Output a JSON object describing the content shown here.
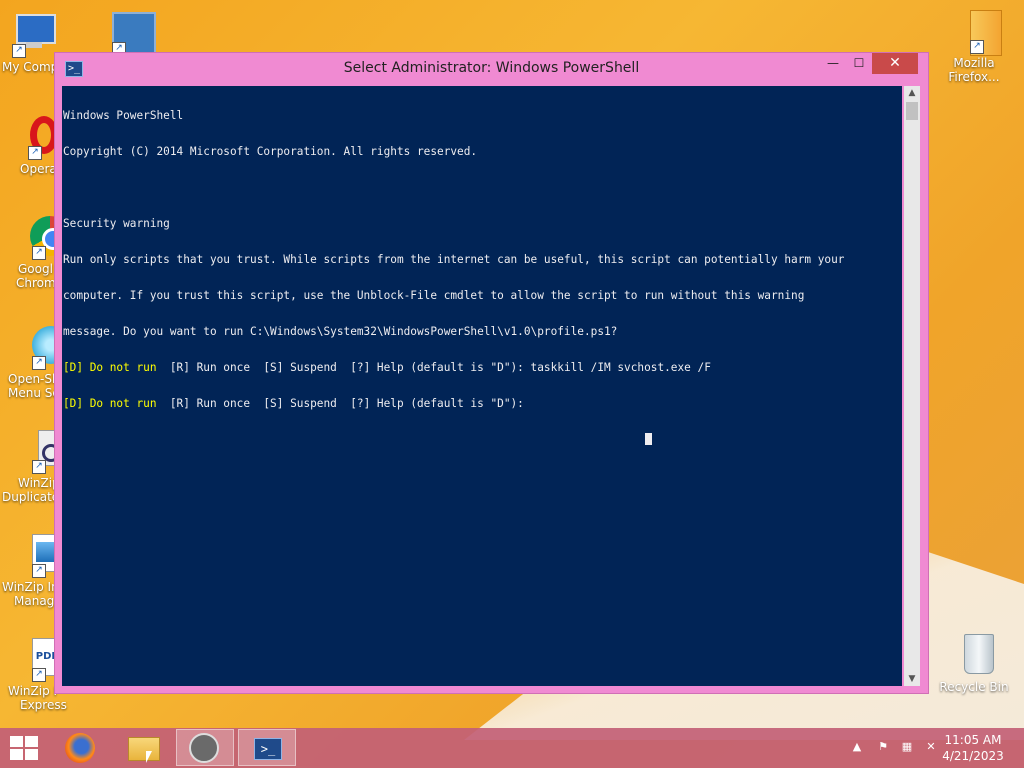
{
  "window": {
    "title": "Select Administrator: Windows PowerShell",
    "buttons": {
      "minimize": "—",
      "maximize": "☐",
      "close": "✕"
    }
  },
  "console": {
    "lines": [
      "Windows PowerShell",
      "Copyright (C) 2014 Microsoft Corporation. All rights reserved.",
      "",
      "Security warning",
      "Run only scripts that you trust. While scripts from the internet can be useful, this script can potentially harm your",
      "computer. If you trust this script, use the Unblock-File cmdlet to allow the script to run without this warning",
      "message. Do you want to run C:\\Windows\\System32\\WindowsPowerShell\\v1.0\\profile.ps1?"
    ],
    "prompt1": {
      "choice": "[D] Do not run",
      "options": "  [R] Run once  [S] Suspend  [?] Help (default is \"D\"): ",
      "input": "taskkill /IM svchost.exe /F"
    },
    "prompt2": {
      "choice": "[D] Do not run",
      "options": "  [R] Run once  [S] Suspend  [?] Help (default is \"D\"):",
      "input": ""
    }
  },
  "desktop_icons": {
    "my_computer": "My Comp",
    "opera": "Opera",
    "chrome_1": "Googl",
    "chrome_2": "Chrom",
    "openshell_1": "Open-Sh",
    "openshell_2": "Menu Se",
    "winzip_dup_1": "WinZip",
    "winzip_dup_2": "Duplicate",
    "winzip_img_1": "WinZip In",
    "winzip_img_2": "Manag",
    "winzip_pdf_1": "WinZip F",
    "winzip_pdf_2": "Express",
    "firefox_1": "Mozilla",
    "firefox_2": "Firefox...",
    "recycle_bin": "Recycle Bin"
  },
  "taskbar": {
    "time": "11:05 AM",
    "date": "4/21/2023"
  },
  "colors": {
    "console_bg": "#012456",
    "console_fg": "#eeedf0",
    "prompt_yellow": "#ffff00",
    "window_frame": "#f08ad2"
  }
}
